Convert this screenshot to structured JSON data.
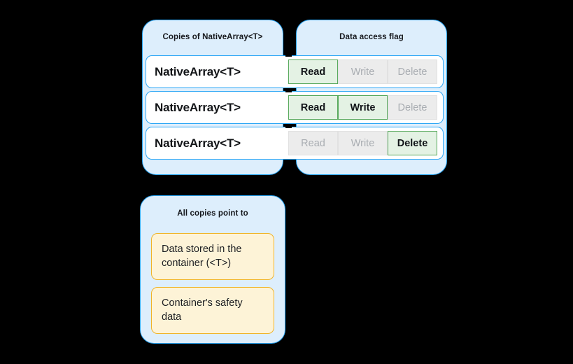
{
  "diagram": {
    "copies_panel": {
      "title": "Copies of NativeArray<T>",
      "rows": [
        {
          "label": "NativeArray<T>",
          "flags": [
            {
              "name": "Read",
              "state": "on"
            },
            {
              "name": "Write",
              "state": "off"
            },
            {
              "name": "Delete",
              "state": "off"
            }
          ]
        },
        {
          "label": "NativeArray<T>",
          "flags": [
            {
              "name": "Read",
              "state": "on"
            },
            {
              "name": "Write",
              "state": "on"
            },
            {
              "name": "Delete",
              "state": "off"
            }
          ]
        },
        {
          "label": "NativeArray<T>",
          "flags": [
            {
              "name": "Read",
              "state": "off"
            },
            {
              "name": "Write",
              "state": "off"
            },
            {
              "name": "Delete",
              "state": "on"
            }
          ]
        }
      ]
    },
    "flag_panel": {
      "title": "Data access flag"
    },
    "pointer_panel": {
      "title": "All copies point to",
      "notes": [
        "Data stored in the container (<T>)",
        "Container's safety data"
      ]
    },
    "colors": {
      "background": "#000000",
      "panel_fill": "#ddeefc",
      "panel_border": "#2ba6f5",
      "row_fill": "#ffffff",
      "flag_on_fill": "#e4f2e4",
      "flag_on_border": "#57a95c",
      "flag_off_fill": "#ececec",
      "flag_off_text": "#a9adb2",
      "note_fill": "#fdf3d7",
      "note_border": "#f0b429",
      "text": "#121417"
    }
  }
}
